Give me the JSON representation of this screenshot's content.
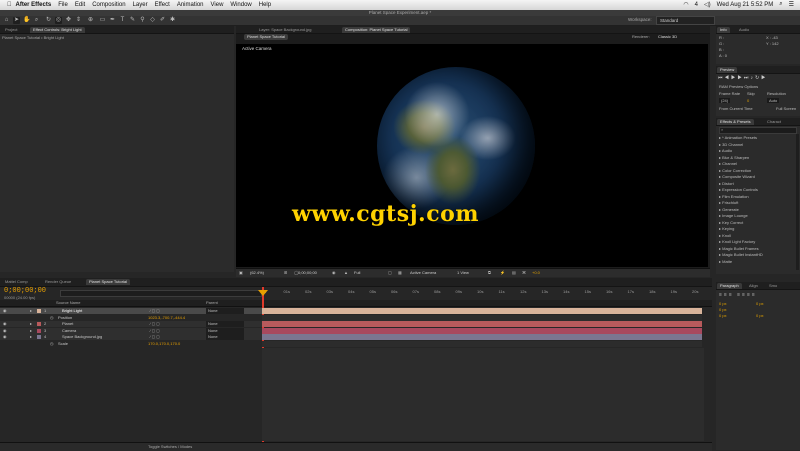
{
  "menubar": {
    "apple": "",
    "app_name": "After Effects",
    "items": [
      "File",
      "Edit",
      "Composition",
      "Layer",
      "Effect",
      "Animation",
      "View",
      "Window",
      "Help"
    ],
    "clock": "Wed Aug 21  5:52 PM",
    "status_num": "4"
  },
  "window": {
    "title": "Planet Space Experiment.aep *"
  },
  "toolbar": {
    "workspace_label": "Workspace:",
    "workspace_value": "Standard"
  },
  "project_panel": {
    "tabs": [
      "Project",
      "Effect Controls: Bright Light"
    ],
    "breadcrumb": "Planet Space Tutorial • Bright Light"
  },
  "viewer": {
    "tabs": [
      "Layer: Space Background.jpg",
      "Composition: Planet Space Tutorial"
    ],
    "comp_button": "Planet Space Tutorial",
    "renderer_label": "Renderer:",
    "renderer_value": "Classic 3D",
    "view_name": "Active Camera",
    "watermark": "www.cgtsj.com",
    "footer": {
      "zoom": "(62.4%)",
      "timecode": "0;00;00;00",
      "resolution": "Full",
      "camera": "Active Camera",
      "views": "1 View",
      "exposure": "+0.0"
    }
  },
  "info_panel": {
    "tabs": [
      "Info",
      "Audio"
    ],
    "r": "R :",
    "g": "G :",
    "b": "B :",
    "a": "A : 0",
    "x": "X : -43",
    "y": "Y : 142"
  },
  "preview_panel": {
    "tab": "Preview",
    "ram_options": "RAM Preview Options",
    "frame_rate_label": "Frame Rate",
    "skip_label": "Skip",
    "resolution_label": "Resolution",
    "frame_rate_value": "(24)",
    "skip_value": "0",
    "resolution_value": "Auto",
    "from_current": "From Current Time",
    "full_screen": "Full Screen"
  },
  "effects_panel": {
    "tabs": [
      "Effects & Presets",
      "Charact"
    ],
    "search_placeholder": "",
    "items": [
      "* Animation Presets",
      "3D Channel",
      "Audio",
      "Blur & Sharpen",
      "Channel",
      "Color Correction",
      "Composite Wizard",
      "Distort",
      "Expression Controls",
      "Film Emulation",
      "Frischluft",
      "Generate",
      "Image Lounge",
      "Key Correct",
      "Keying",
      "Knoll",
      "Knoll Light Factory",
      "Magic Bullet Frames",
      "Magic Bullet InstantHD",
      "Matte"
    ]
  },
  "paragraph_panel": {
    "tabs": [
      "Paragraph",
      "Align",
      "Smo"
    ],
    "fields": [
      "0 px",
      "0 px",
      "0 px",
      "0 px",
      "0 px"
    ]
  },
  "timeline": {
    "tabs": [
      "Render Queue",
      "Planet Space Tutorial"
    ],
    "extra_tab": "Mattel Comp",
    "timecode": "0;00;00;00",
    "fps": "00000 (24.00 fps)",
    "col_source": "Source Name",
    "col_parent": "Parent",
    "ruler": [
      "0s",
      "01s",
      "02s",
      "03s",
      "04s",
      "05s",
      "06s",
      "07s",
      "08s",
      "09s",
      "10s",
      "11s",
      "12s",
      "13s",
      "14s",
      "15s",
      "16s",
      "17s",
      "18s",
      "19s",
      "20s"
    ],
    "layers": [
      {
        "num": "1",
        "name": "Bright Light",
        "parent": "None"
      },
      {
        "num": "",
        "name": "Position",
        "value": "1023.3,-700.7,-444.4",
        "parent": ""
      },
      {
        "num": "2",
        "name": "Planet",
        "parent": "None"
      },
      {
        "num": "3",
        "name": "Camera",
        "parent": "None"
      },
      {
        "num": "4",
        "name": "Space Background.jpg",
        "parent": "None"
      },
      {
        "num": "",
        "name": "Scale",
        "value": "170.0,170.0,170.0",
        "parent": ""
      }
    ],
    "footer_toggle": "Toggle Switches / Modes"
  },
  "colors": {
    "accent": "#e08a00",
    "bar_light": "#d8b39a",
    "bar_planet": "#b85a5c",
    "bar_camera": "#a8495e",
    "bar_bg": "#7b7690",
    "watermark": "#ffd200",
    "timecode": "#e8a000"
  }
}
